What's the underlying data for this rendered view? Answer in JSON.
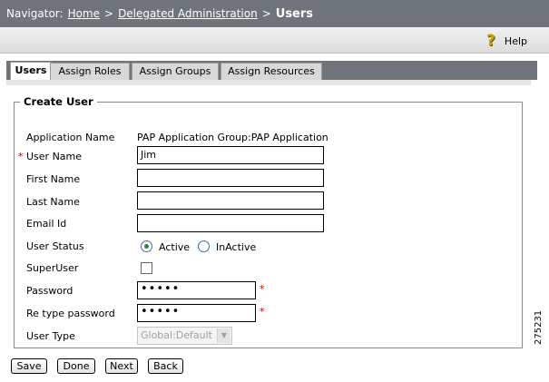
{
  "navigator": {
    "prefix": "Navigator:",
    "crumbs": [
      "Home",
      "Delegated Administration"
    ],
    "separator": ">",
    "current": "Users"
  },
  "help": {
    "label": "Help",
    "icon": "help-question-icon"
  },
  "tabs": [
    {
      "label": "Users",
      "active": true
    },
    {
      "label": "Assign Roles",
      "active": false
    },
    {
      "label": "Assign Groups",
      "active": false
    },
    {
      "label": "Assign Resources",
      "active": false
    }
  ],
  "form": {
    "legend": "Create User",
    "application_name_label": "Application Name",
    "application_name_value": "PAP Application Group:PAP Application",
    "user_name_label": "User Name",
    "user_name_value": "Jim",
    "first_name_label": "First Name",
    "first_name_value": "",
    "last_name_label": "Last Name",
    "last_name_value": "",
    "email_label": "Email Id",
    "email_value": "",
    "user_status_label": "User Status",
    "status_active_label": "Active",
    "status_inactive_label": "InActive",
    "status_selected": "Active",
    "superuser_label": "SuperUser",
    "superuser_checked": false,
    "password_label": "Password",
    "password_value": "•••••",
    "retype_label": "Re type password",
    "retype_value": "•••••",
    "user_type_label": "User Type",
    "user_type_value": "Global:Default",
    "required_marker": "*"
  },
  "buttons": {
    "save": "Save",
    "done": "Done",
    "next": "Next",
    "back": "Back"
  },
  "figure_id": "275231"
}
